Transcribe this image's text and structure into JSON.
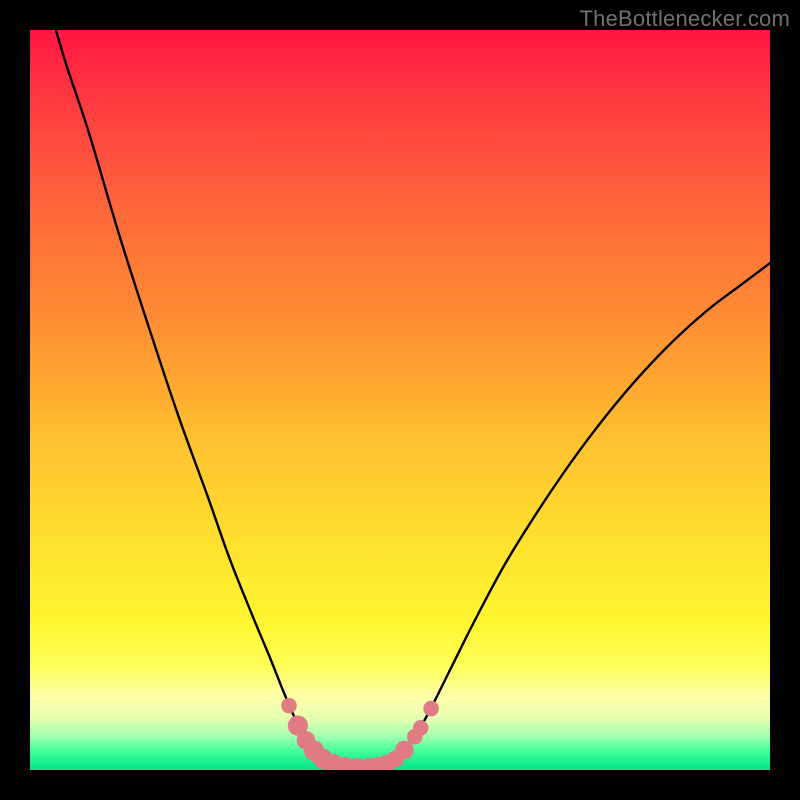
{
  "colors": {
    "frame": "#000000",
    "watermark_text": "#71716f",
    "gradient_stops": [
      {
        "offset": 0.0,
        "color": "#ff1744"
      },
      {
        "offset": 0.1,
        "color": "#ff3b3f"
      },
      {
        "offset": 0.25,
        "color": "#ff6a3a"
      },
      {
        "offset": 0.4,
        "color": "#ff8f33"
      },
      {
        "offset": 0.55,
        "color": "#ffc02f"
      },
      {
        "offset": 0.7,
        "color": "#ffe22f"
      },
      {
        "offset": 0.8,
        "color": "#fff62f"
      },
      {
        "offset": 0.86,
        "color": "#ffff5a"
      },
      {
        "offset": 0.9,
        "color": "#ffffa8"
      },
      {
        "offset": 0.93,
        "color": "#e6ffb0"
      },
      {
        "offset": 0.955,
        "color": "#9fffae"
      },
      {
        "offset": 0.975,
        "color": "#3fff9a"
      },
      {
        "offset": 1.0,
        "color": "#00e48a"
      }
    ],
    "curve": "#000000",
    "marker_fill": "#e07b83",
    "marker_stroke": "#e07b83"
  },
  "watermark": "TheBottlenecker.com",
  "chart_data": {
    "type": "line",
    "title": "",
    "xlabel": "",
    "ylabel": "",
    "xlim": [
      0,
      100
    ],
    "ylim": [
      0,
      100
    ],
    "curve_points": [
      {
        "x": 3.5,
        "y": 100.0
      },
      {
        "x": 5.0,
        "y": 95.0
      },
      {
        "x": 8.0,
        "y": 86.0
      },
      {
        "x": 12.0,
        "y": 72.5
      },
      {
        "x": 16.0,
        "y": 60.0
      },
      {
        "x": 20.0,
        "y": 48.0
      },
      {
        "x": 24.0,
        "y": 37.0
      },
      {
        "x": 27.0,
        "y": 28.5
      },
      {
        "x": 30.0,
        "y": 21.0
      },
      {
        "x": 32.5,
        "y": 15.0
      },
      {
        "x": 34.5,
        "y": 10.0
      },
      {
        "x": 36.5,
        "y": 5.5
      },
      {
        "x": 38.0,
        "y": 3.0
      },
      {
        "x": 39.5,
        "y": 1.5
      },
      {
        "x": 41.0,
        "y": 0.8
      },
      {
        "x": 43.0,
        "y": 0.3
      },
      {
        "x": 45.0,
        "y": 0.2
      },
      {
        "x": 47.0,
        "y": 0.4
      },
      {
        "x": 49.0,
        "y": 1.2
      },
      {
        "x": 50.5,
        "y": 2.5
      },
      {
        "x": 52.0,
        "y": 4.5
      },
      {
        "x": 54.0,
        "y": 8.0
      },
      {
        "x": 57.0,
        "y": 14.0
      },
      {
        "x": 60.0,
        "y": 20.0
      },
      {
        "x": 64.0,
        "y": 27.5
      },
      {
        "x": 68.0,
        "y": 34.0
      },
      {
        "x": 72.0,
        "y": 40.0
      },
      {
        "x": 76.0,
        "y": 45.5
      },
      {
        "x": 80.0,
        "y": 50.5
      },
      {
        "x": 84.0,
        "y": 55.0
      },
      {
        "x": 88.0,
        "y": 59.0
      },
      {
        "x": 92.0,
        "y": 62.5
      },
      {
        "x": 96.0,
        "y": 65.5
      },
      {
        "x": 100.0,
        "y": 68.5
      }
    ],
    "markers": [
      {
        "x": 35.0,
        "y": 8.7,
        "r": 1.0
      },
      {
        "x": 36.2,
        "y": 6.0,
        "r": 1.3
      },
      {
        "x": 37.3,
        "y": 4.0,
        "r": 1.2
      },
      {
        "x": 38.4,
        "y": 2.6,
        "r": 1.3
      },
      {
        "x": 39.6,
        "y": 1.5,
        "r": 1.3
      },
      {
        "x": 41.0,
        "y": 0.8,
        "r": 1.3
      },
      {
        "x": 42.6,
        "y": 0.4,
        "r": 1.3
      },
      {
        "x": 44.2,
        "y": 0.25,
        "r": 1.3
      },
      {
        "x": 45.8,
        "y": 0.25,
        "r": 1.3
      },
      {
        "x": 47.0,
        "y": 0.4,
        "r": 1.3
      },
      {
        "x": 48.2,
        "y": 0.8,
        "r": 1.2
      },
      {
        "x": 49.4,
        "y": 1.5,
        "r": 1.1
      },
      {
        "x": 50.6,
        "y": 2.7,
        "r": 1.2
      },
      {
        "x": 52.0,
        "y": 4.5,
        "r": 1.0
      },
      {
        "x": 52.8,
        "y": 5.7,
        "r": 1.0
      },
      {
        "x": 54.2,
        "y": 8.3,
        "r": 1.0
      }
    ]
  }
}
